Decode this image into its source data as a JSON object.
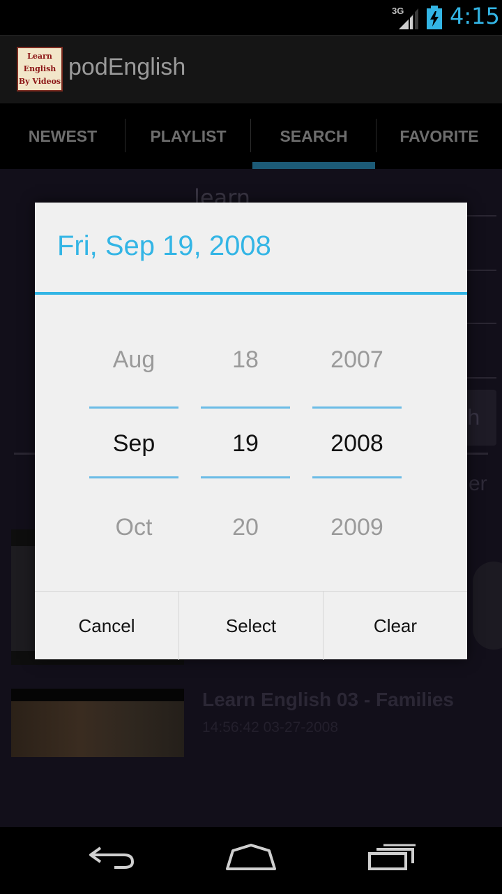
{
  "status_bar": {
    "network": "3G",
    "time": "4:15"
  },
  "app": {
    "icon_text": [
      "Learn",
      "English",
      "By Videos"
    ],
    "title": "podEnglish"
  },
  "tabs": [
    {
      "label": "NEWEST",
      "active": false
    },
    {
      "label": "PLAYLIST",
      "active": false
    },
    {
      "label": "SEARCH",
      "active": true
    },
    {
      "label": "FAVORITE",
      "active": false
    }
  ],
  "background": {
    "search_value": "learn",
    "search_button_partial": "ch",
    "partial_text_right": "er",
    "video_item": {
      "title": "Learn English 03 - Families",
      "meta": "14:56:42 03-27-2008"
    }
  },
  "dialog": {
    "title": "Fri, Sep 19, 2008",
    "month": {
      "prev": "Aug",
      "current": "Sep",
      "next": "Oct"
    },
    "day": {
      "prev": "18",
      "current": "19",
      "next": "20"
    },
    "year": {
      "prev": "2007",
      "current": "2008",
      "next": "2009"
    },
    "buttons": {
      "cancel": "Cancel",
      "select": "Select",
      "clear": "Clear"
    }
  },
  "colors": {
    "accent": "#33b5e5",
    "tab_indicator": "#1c5a76"
  },
  "nav_icons": [
    "back-icon",
    "home-icon",
    "recent-apps-icon"
  ]
}
